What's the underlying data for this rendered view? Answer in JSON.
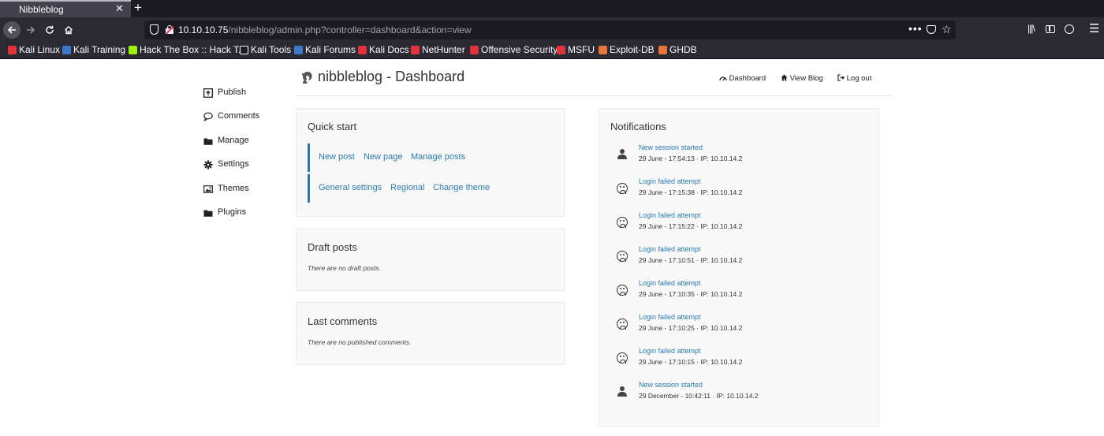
{
  "browser": {
    "tab_title": "Nibbleblog",
    "tab_close": "✕",
    "new_tab": "+",
    "url_host": "10.10.10.75",
    "url_path": "/nibbleblog/admin.php?controller=dashboard&action=view",
    "url_more": "•••",
    "bookmarks": [
      {
        "label": "Kali Linux",
        "icon": "kali-icon",
        "color": "#e0323f"
      },
      {
        "label": "Kali Training",
        "icon": "kali-icon",
        "color": "#3b78c8"
      },
      {
        "label": "Hack The Box :: Hack T...",
        "icon": "htb-icon",
        "color": "#9fef00"
      },
      {
        "label": "Kali Tools",
        "icon": "kali-icon",
        "color": "#fbfbfe"
      },
      {
        "label": "Kali Forums",
        "icon": "kali-icon",
        "color": "#3b78c8"
      },
      {
        "label": "Kali Docs",
        "icon": "kali-icon",
        "color": "#e0323f"
      },
      {
        "label": "NetHunter",
        "icon": "kali-icon",
        "color": "#e0323f"
      },
      {
        "label": "Offensive Security",
        "icon": "offsec-icon",
        "color": "#e0323f"
      },
      {
        "label": "MSFU",
        "icon": "msf-icon",
        "color": "#e0323f"
      },
      {
        "label": "Exploit-DB",
        "icon": "exploitdb-icon",
        "color": "#e8753a"
      },
      {
        "label": "GHDB",
        "icon": "exploitdb-icon",
        "color": "#e8753a"
      }
    ]
  },
  "sidebar": {
    "items": [
      {
        "label": "Publish",
        "icon": "publish-icon"
      },
      {
        "label": "Comments",
        "icon": "comment-icon"
      },
      {
        "label": "Manage",
        "icon": "folder-icon"
      },
      {
        "label": "Settings",
        "icon": "gear-icon"
      },
      {
        "label": "Themes",
        "icon": "image-icon"
      },
      {
        "label": "Plugins",
        "icon": "folder-icon"
      }
    ]
  },
  "header": {
    "title": "nibbleblog - Dashboard",
    "nav": [
      {
        "label": "Dashboard",
        "icon": "dashboard-icon"
      },
      {
        "label": "View Blog",
        "icon": "home-icon"
      },
      {
        "label": "Log out",
        "icon": "logout-icon"
      }
    ]
  },
  "quick_start": {
    "title": "Quick start",
    "row1": [
      "New post",
      "New page",
      "Manage posts"
    ],
    "row2": [
      "General settings",
      "Regional",
      "Change theme"
    ]
  },
  "draft_posts": {
    "title": "Draft posts",
    "empty": "There are no draft posts."
  },
  "last_comments": {
    "title": "Last comments",
    "empty": "There are no published comments."
  },
  "notifications": {
    "title": "Notifications",
    "items": [
      {
        "title": "New session started",
        "meta": "29 June - 17:54:13 · IP: 10.10.14.2",
        "icon": "user-icon"
      },
      {
        "title": "Login failed attempt",
        "meta": "29 June - 17:15:38 · IP: 10.10.14.2",
        "icon": "sad-face-icon"
      },
      {
        "title": "Login failed attempt",
        "meta": "29 June - 17:15:22 · IP: 10.10.14.2",
        "icon": "sad-face-icon"
      },
      {
        "title": "Login failed attempt",
        "meta": "29 June - 17:10:51 · IP: 10.10.14.2",
        "icon": "sad-face-icon"
      },
      {
        "title": "Login failed attempt",
        "meta": "29 June - 17:10:35 · IP: 10.10.14.2",
        "icon": "sad-face-icon"
      },
      {
        "title": "Login failed attempt",
        "meta": "29 June - 17:10:25 · IP: 10.10.14.2",
        "icon": "sad-face-icon"
      },
      {
        "title": "Login failed attempt",
        "meta": "29 June - 17:10:15 · IP: 10.10.14.2",
        "icon": "sad-face-icon"
      },
      {
        "title": "New session started",
        "meta": "29 December - 10:42:11 · IP: 10.10.14.2",
        "icon": "user-icon"
      }
    ]
  },
  "colors": {
    "link": "#2a7ab0",
    "chrome_bg": "#2b2a33",
    "panel_bg": "#f9f9f9"
  }
}
